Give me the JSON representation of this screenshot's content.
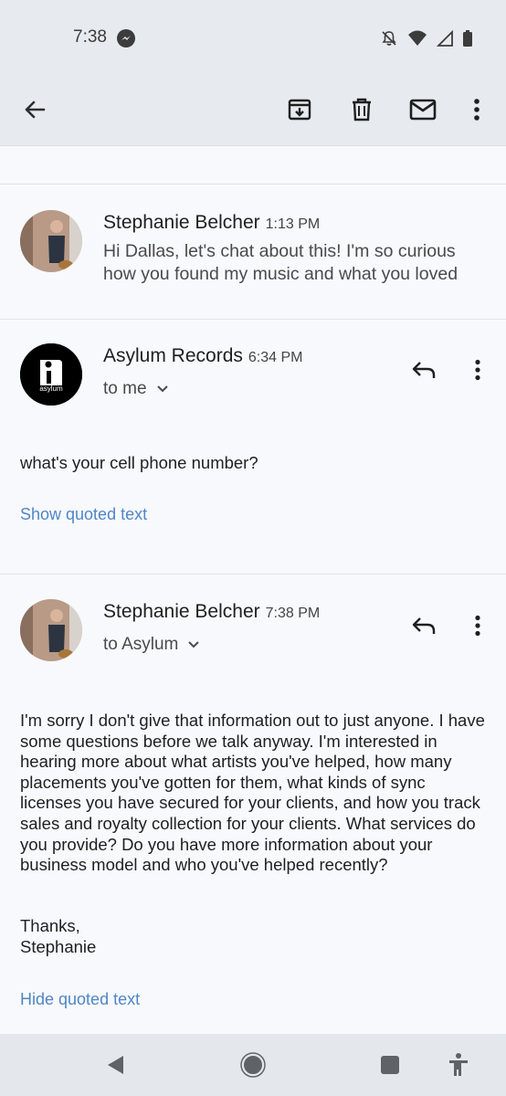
{
  "status_bar": {
    "time": "7:38",
    "icons": [
      "messenger-icon",
      "bell-off-icon",
      "wifi-icon",
      "signal-icon",
      "battery-icon"
    ]
  },
  "toolbar": {
    "icons": [
      "back-arrow-icon",
      "archive-icon",
      "delete-icon",
      "mark-unread-icon",
      "more-vert-icon"
    ]
  },
  "messages": [
    {
      "sender": "Stephanie Belcher",
      "time": "1:13 PM",
      "snippet": "Hi Dallas, let's chat about this! I'm so curious how you found my music and what you loved"
    },
    {
      "sender": "Asylum Records",
      "time": "6:34 PM",
      "to": "to me",
      "avatar_text": "asylum",
      "body": "what's your cell phone number?",
      "quoted_link": "Show quoted text"
    },
    {
      "sender": "Stephanie Belcher",
      "time": "7:38 PM",
      "to": "to Asylum",
      "body": "I'm sorry I don't give that information out to just anyone. I have some questions before we talk anyway. I'm interested in hearing more about what artists you've helped, how many placements you've gotten for them, what kinds of sync licenses you have secured for your clients, and how you track sales and royalty collection for your clients. What services do you provide? Do you have more information about your business model and who you've helped recently?",
      "signoff_1": "Thanks,",
      "signoff_2": "Stephanie",
      "quoted_link": "Hide quoted text"
    }
  ],
  "nav_bar": {
    "icons": [
      "back-triangle-icon",
      "home-circle-icon",
      "recents-square-icon",
      "accessibility-icon"
    ]
  },
  "colors": {
    "header_bg": "#e7ebef",
    "link": "#4f86c6",
    "page_bg": "#f8f9fc"
  }
}
